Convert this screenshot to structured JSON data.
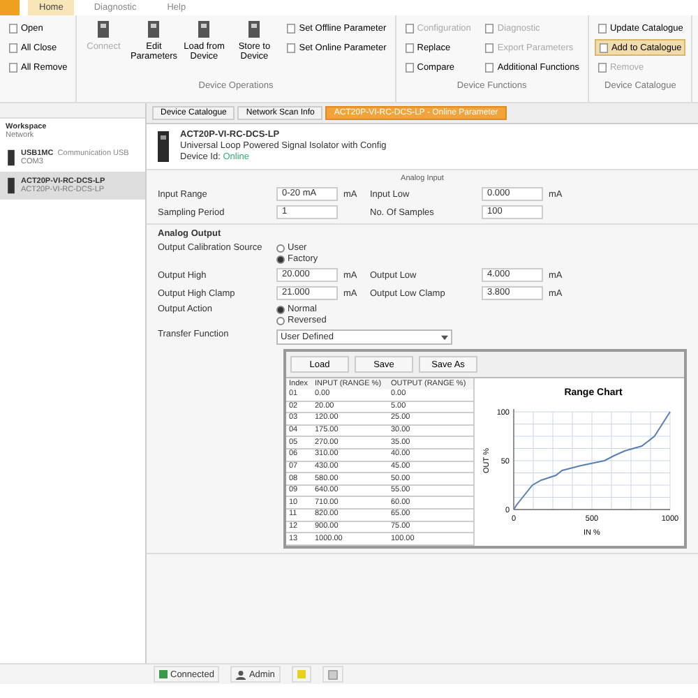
{
  "ribbon": {
    "tabs": [
      {
        "label": "Home",
        "selected": true
      },
      {
        "label": "Diagnostic",
        "selected": false
      },
      {
        "label": "Help",
        "selected": false
      }
    ],
    "groups": [
      {
        "items": [
          {
            "label": "Open",
            "kind": "small"
          },
          {
            "label": "All Close",
            "kind": "small"
          },
          {
            "label": "All Remove",
            "kind": "small"
          }
        ]
      },
      {
        "label": "Device Operations",
        "items": [
          {
            "label": "Connect",
            "kind": "large",
            "disabled": true
          },
          {
            "label": "Edit Parameters",
            "kind": "large",
            "disabled": false
          },
          {
            "label": "Load from Device",
            "kind": "large",
            "disabled": false
          },
          {
            "label": "Store to Device",
            "kind": "large",
            "disabled": false
          },
          {
            "label": "Set Offline Parameter",
            "kind": "small",
            "disabled": false
          },
          {
            "label": "Set Online Parameter",
            "kind": "small",
            "disabled": false
          }
        ]
      },
      {
        "label": "Device Functions",
        "items": [
          {
            "label": "Configuration",
            "kind": "small",
            "disabled": true
          },
          {
            "label": "Replace",
            "kind": "small",
            "disabled": false
          },
          {
            "label": "Compare",
            "kind": "small",
            "disabled": false
          },
          {
            "label": "Diagnostic",
            "kind": "small",
            "disabled": true
          },
          {
            "label": "Export Parameters",
            "kind": "small",
            "disabled": true
          },
          {
            "label": "Additional Functions",
            "kind": "small",
            "disabled": false
          }
        ]
      },
      {
        "label": "Device Catalogue",
        "items": [
          {
            "label": "Update Catalogue",
            "kind": "small",
            "disabled": false
          },
          {
            "label": "Add to Catalogue",
            "kind": "small",
            "disabled": false,
            "selected": true
          },
          {
            "label": "Remove",
            "kind": "small",
            "disabled": true
          }
        ]
      }
    ]
  },
  "sidebar": {
    "items": [
      {
        "title": "Workspace",
        "subtitle": "Network"
      },
      {
        "title": "USB1MC",
        "subtitle": "COM3",
        "extra": "Communication USB"
      },
      {
        "title": "ACT20P-VI-RC-DCS-LP",
        "subtitle": "ACT20P-VI-RC-DCS-LP",
        "selected": true
      }
    ]
  },
  "doc_tabs": [
    {
      "label": "Device Catalogue",
      "selected": false
    },
    {
      "label": "Network Scan Info",
      "selected": false
    },
    {
      "label": "ACT20P-VI-RC-DCS-LP - Online Parameter",
      "selected": true
    }
  ],
  "device": {
    "name": "ACT20P-VI-RC-DCS-LP",
    "description": "Universal Loop Powered Signal Isolator with Config",
    "status_label": "Device Id:",
    "status_value": "Online"
  },
  "input": {
    "heading": "Analog Input",
    "fields": [
      {
        "label": "Input Range",
        "value": "0-20 mA",
        "unit": "mA"
      },
      {
        "label": "Input Low",
        "value": "0.000",
        "unit": "mA"
      },
      {
        "label": "Sampling Period",
        "value": "1"
      },
      {
        "label": "No. Of Samples",
        "value": "100"
      }
    ]
  },
  "output": {
    "heading": "Analog Output",
    "calibration_label": "Output Calibration Source",
    "calibration": [
      {
        "label": "User",
        "selected": false
      },
      {
        "label": "Factory",
        "selected": true
      }
    ],
    "fields": [
      {
        "label": "Output High",
        "value": "20.000",
        "unit": "mA"
      },
      {
        "label": "Output Low",
        "value": "4.000",
        "unit": "mA"
      },
      {
        "label": "Output High Clamp",
        "value": "21.000",
        "unit": "mA"
      },
      {
        "label": "Output Low Clamp",
        "value": "3.800",
        "unit": "mA"
      }
    ],
    "action_label": "Output Action",
    "action": [
      {
        "label": "Normal",
        "selected": true
      },
      {
        "label": "Reversed",
        "selected": false
      }
    ],
    "transfer_label": "Transfer Function",
    "transfer_value": "User Defined"
  },
  "table": {
    "buttons": [
      "Load",
      "Save",
      "Save As"
    ],
    "columns": [
      "Index",
      "INPUT (RANGE %)",
      "OUTPUT (RANGE %)"
    ],
    "rows": [
      [
        "01",
        "0.00",
        "0.00"
      ],
      [
        "02",
        "20.00",
        "5.00"
      ],
      [
        "03",
        "120.00",
        "25.00"
      ],
      [
        "04",
        "175.00",
        "30.00"
      ],
      [
        "05",
        "270.00",
        "35.00"
      ],
      [
        "06",
        "310.00",
        "40.00"
      ],
      [
        "07",
        "430.00",
        "45.00"
      ],
      [
        "08",
        "580.00",
        "50.00"
      ],
      [
        "09",
        "640.00",
        "55.00"
      ],
      [
        "10",
        "710.00",
        "60.00"
      ],
      [
        "11",
        "820.00",
        "65.00"
      ],
      [
        "12",
        "900.00",
        "75.00"
      ],
      [
        "13",
        "1000.00",
        "100.00"
      ]
    ]
  },
  "chart": {
    "chart_data": {
      "type": "line",
      "title": "Range Chart",
      "xlabel": "IN %",
      "ylabel": "OUT %",
      "x": [
        0,
        20,
        120,
        175,
        270,
        310,
        430,
        580,
        640,
        710,
        820,
        900,
        1000
      ],
      "series": [
        {
          "color": "#5a7fb0",
          "values": [
            0,
            5,
            25,
            30,
            35,
            40,
            45,
            50,
            55,
            60,
            65,
            75,
            100
          ]
        }
      ],
      "xlim": [
        0,
        1000
      ],
      "ylim": [
        0,
        100
      ],
      "xticks": [
        0,
        500,
        1000
      ],
      "yticks": [
        0,
        50,
        100
      ]
    }
  },
  "status_bar": [
    {
      "label": "Connected",
      "kind": "green"
    },
    {
      "label": "Admin",
      "kind": "user"
    },
    {
      "kind": "yellow"
    },
    {
      "kind": "disk"
    }
  ]
}
